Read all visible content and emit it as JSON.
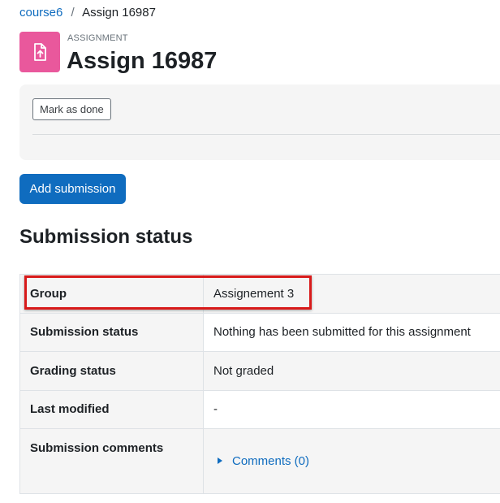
{
  "breadcrumb": {
    "course": "course6",
    "separator": "/",
    "current": "Assign 16987"
  },
  "header": {
    "activity_type": "ASSIGNMENT",
    "title": "Assign 16987",
    "icon": "assignment-file-upload-icon",
    "icon_color": "#e9589c"
  },
  "completion": {
    "mark_done_label": "Mark as done"
  },
  "actions": {
    "add_submission_label": "Add submission"
  },
  "submission_status": {
    "heading": "Submission status",
    "rows": [
      {
        "label": "Group",
        "value": "Assignement 3"
      },
      {
        "label": "Submission status",
        "value": "Nothing has been submitted for this assignment"
      },
      {
        "label": "Grading status",
        "value": "Not graded"
      },
      {
        "label": "Last modified",
        "value": "-"
      },
      {
        "label": "Submission comments",
        "value": "Comments (0)"
      }
    ]
  },
  "colors": {
    "accent": "#0f6cbf",
    "highlight": "#d81a1a"
  }
}
